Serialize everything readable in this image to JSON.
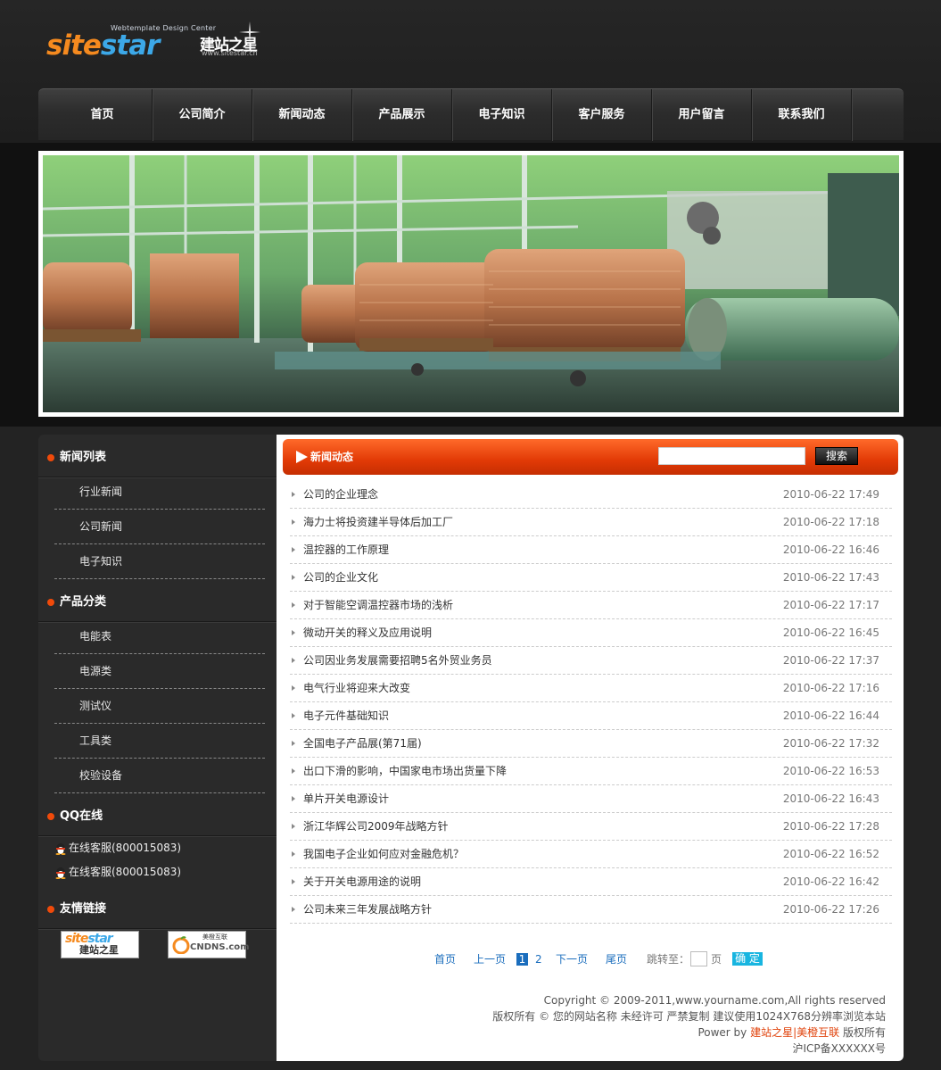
{
  "header": {
    "logo_tagline": "Webtemplate Design Center",
    "logo_text_part1": "site",
    "logo_text_part2": "star",
    "logo_cn": "建站之星",
    "logo_url": "www.sitestar.cn"
  },
  "nav": {
    "items": [
      "首页",
      "公司简介",
      "新闻动态",
      "产品展示",
      "电子知识",
      "客户服务",
      "用户留言",
      "联系我们"
    ]
  },
  "sidebar": {
    "news_title": "新闻列表",
    "news_items": [
      "行业新闻",
      "公司新闻",
      "电子知识"
    ],
    "product_title": "产品分类",
    "product_items": [
      "电能表",
      "电源类",
      "测试仪",
      "工具类",
      "校验设备"
    ],
    "qq_title": "QQ在线",
    "qq_items": [
      "在线客服(800015083)",
      "在线客服(800015083)"
    ],
    "links_title": "友情链接",
    "links": [
      {
        "line1a": "site",
        "line1b": "star",
        "line2": "建站之星"
      },
      {
        "line1": "CNDNS.com",
        "tag": "美橙互联"
      }
    ]
  },
  "main": {
    "title": "新闻动态",
    "search_value": "",
    "search_button": "搜索",
    "news": [
      {
        "title": "公司的企业理念",
        "date": "2010-06-22 17:49"
      },
      {
        "title": "海力士将投资建半导体后加工厂",
        "date": "2010-06-22 17:18"
      },
      {
        "title": "温控器的工作原理",
        "date": "2010-06-22 16:46"
      },
      {
        "title": "公司的企业文化",
        "date": "2010-06-22 17:43"
      },
      {
        "title": "对于智能空调温控器市场的浅析",
        "date": "2010-06-22 17:17"
      },
      {
        "title": "微动开关的释义及应用说明",
        "date": "2010-06-22 16:45"
      },
      {
        "title": "公司因业务发展需要招聘5名外贸业务员",
        "date": "2010-06-22 17:37"
      },
      {
        "title": "电气行业将迎来大改变",
        "date": "2010-06-22 17:16"
      },
      {
        "title": "电子元件基础知识",
        "date": "2010-06-22 16:44"
      },
      {
        "title": "全国电子产品展(第71届)",
        "date": "2010-06-22 17:32"
      },
      {
        "title": "出口下滑的影响，中国家电市场出货量下降",
        "date": "2010-06-22 16:53"
      },
      {
        "title": "单片开关电源设计",
        "date": "2010-06-22 16:43"
      },
      {
        "title": "浙江华辉公司2009年战略方针",
        "date": "2010-06-22 17:28"
      },
      {
        "title": "我国电子企业如何应对金融危机？",
        "date": "2010-06-22 16:52"
      },
      {
        "title": "关于开关电源用途的说明",
        "date": "2010-06-22 16:42"
      },
      {
        "title": "公司未来三年发展战略方针",
        "date": "2010-06-22 17:26"
      }
    ],
    "pager": {
      "first": "首页",
      "prev": "上一页",
      "current": "1",
      "page2": "2",
      "next": "下一页",
      "last": "尾页",
      "jump_label": "跳转至：",
      "page_unit": "页",
      "go": "确 定"
    }
  },
  "footer": {
    "line1": "Copyright © 2009-2011,www.yourname.com,All rights reserved",
    "line2": "版权所有 © 您的网站名称 未经许可 严禁复制 建议使用1024X768分辨率浏览本站",
    "line3_prefix": "Power by ",
    "line3_link1": "建站之星",
    "line3_sep": "|",
    "line3_link2": "美橙互联",
    "line3_suffix": " 版权所有",
    "line4": "沪ICP备XXXXXX号"
  },
  "colors": {
    "accent": "#e23a06",
    "link": "#1a6dbd",
    "background": "#232323"
  }
}
